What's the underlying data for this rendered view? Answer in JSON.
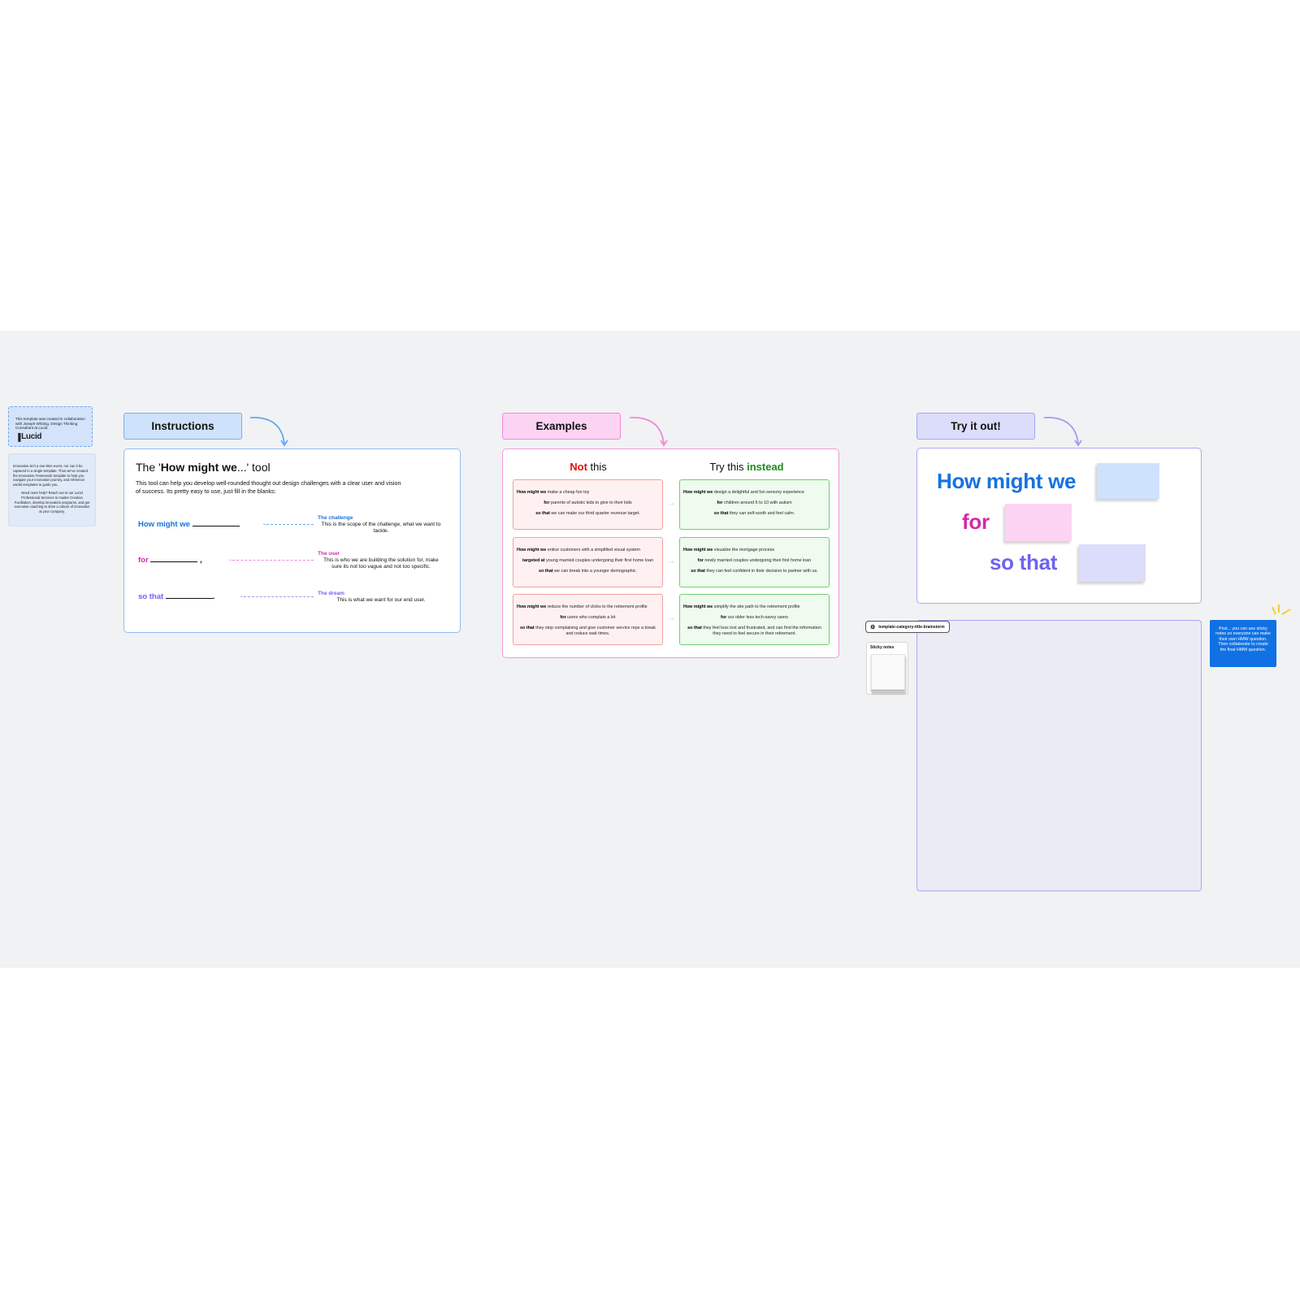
{
  "credit_note": {
    "text": "This template was created in collaboration with Joseph Whiting, Design Thinking Consultant at Lucid.",
    "logo": "Lucid"
  },
  "info_note": {
    "paragraph1": "Innovation isn't a one-time event, nor can it be captured in a single template. Thus we've created the Innovation Framework template to help you navigate your innovation journey, and reference useful templates to guide you.",
    "paragraph2": "Need more help? Reach out to our Lucid Professional Services to master Creative Facilitation, develop innovation programs, and get executive coaching to drive a culture of innovation at your company."
  },
  "sections": {
    "instructions": "Instructions",
    "examples": "Examples",
    "try": "Try it out!"
  },
  "instructions": {
    "title_pre": "The '",
    "title_bold": "How might we",
    "title_post": "...' tool",
    "description": "This tool can help you develop well-rounded thought out design challenges with a clear user and vision of success. Its pretty easy to use, just fill in the blanks:",
    "rows": [
      {
        "label": "How might we",
        "suffix": "",
        "note_title": "The challenge",
        "note_text": "This is the scope of the challenge, what we want to tackle."
      },
      {
        "label": "for",
        "suffix": ",",
        "note_title": "The user",
        "note_text": "This is who we are building the solution for, make sure its not too vague and not too specific."
      },
      {
        "label": "so that",
        "suffix": ".",
        "note_title": "The dream",
        "note_text": "This is what we want for our end user."
      }
    ]
  },
  "examples": {
    "bad_head_bold": "Not",
    "bad_head_rest": " this",
    "good_head_pre": "Try this ",
    "good_head_bold": "instead",
    "pairs": [
      {
        "bad": [
          {
            "k": "How might we",
            "v": " make a cheap fun toy"
          },
          {
            "k": "for",
            "v": " parents of autistic kids to give to their kids"
          },
          {
            "k": "so that",
            "v": " we can make our third quarter revenue target."
          }
        ],
        "good": [
          {
            "k": "How might we",
            "v": " design a delightful and fun sensory experience"
          },
          {
            "k": "for",
            "v": " children around 6 to 10 with autism"
          },
          {
            "k": "so that",
            "v": " they can self-sooth and feel calm."
          }
        ]
      },
      {
        "bad": [
          {
            "k": "How might we",
            "v": " entice customers with a simplified visual system"
          },
          {
            "k": "targeted at",
            "v": " young married couples undergoing their first home loan"
          },
          {
            "k": "so that",
            "v": " we can break into a younger demographic."
          }
        ],
        "good": [
          {
            "k": "How might we",
            "v": " visualize the mortgage process"
          },
          {
            "k": "for",
            "v": " newly married couples undergoing their first home loan"
          },
          {
            "k": "so that",
            "v": " they can feel confident in their decision to partner with us."
          }
        ]
      },
      {
        "bad": [
          {
            "k": "How might we",
            "v": " reduce the number of clicks to the retirement profile"
          },
          {
            "k": "for",
            "v": " users who complain a lot"
          },
          {
            "k": "so that",
            "v": " they stop complaining and give customer service reps a break and reduce wait times."
          }
        ],
        "good": [
          {
            "k": "How might we",
            "v": " simplify the site path to the retirement profile"
          },
          {
            "k": "for",
            "v": " our older less tech-savvy users"
          },
          {
            "k": "so that",
            "v": " they feel less lost and frustrated, and can find the information they need to feel secure in their retirement."
          }
        ]
      }
    ]
  },
  "try": {
    "line1": "How might we",
    "line2": "for",
    "line3": "so that"
  },
  "toolbox": {
    "chip_label": "template-category-title-brainstorm",
    "chip_icon": "shapes-icon",
    "palette_title": "Sticky notes"
  },
  "callout": {
    "text": "Psst... you can use sticky notes so everyone can make their own HMW question. Then collaborate to create the final HMW question."
  },
  "colors": {
    "blue": "#1672e0",
    "pink": "#d62aa8",
    "purple": "#6e63ee",
    "red": "#e01010",
    "green": "#1a8f1a",
    "sticky_blue": "#cfe2fb",
    "sticky_pink": "#fdd3f4",
    "sticky_purple": "#dcdcfb",
    "canvas": "#f1f2f4"
  }
}
